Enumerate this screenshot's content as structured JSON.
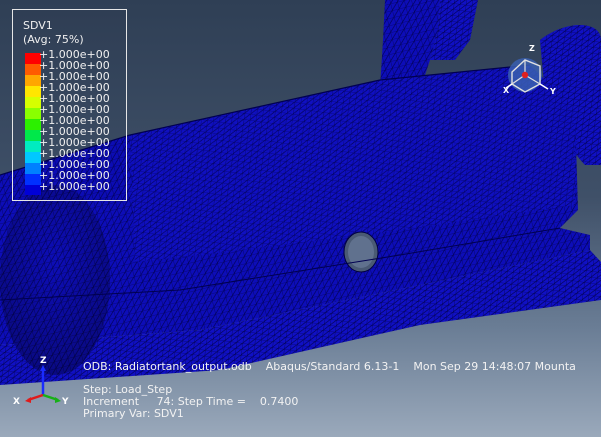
{
  "legend": {
    "title": "SDV1",
    "averaging": "(Avg: 75%)",
    "entries": [
      {
        "label": "+1.000e+00",
        "color": "#ff0000"
      },
      {
        "label": "+1.000e+00",
        "color": "#ff5a00"
      },
      {
        "label": "+1.000e+00",
        "color": "#ffa600"
      },
      {
        "label": "+1.000e+00",
        "color": "#ffe600"
      },
      {
        "label": "+1.000e+00",
        "color": "#d6ff00"
      },
      {
        "label": "+1.000e+00",
        "color": "#8aff00"
      },
      {
        "label": "+1.000e+00",
        "color": "#2cf000"
      },
      {
        "label": "+1.000e+00",
        "color": "#00e84a"
      },
      {
        "label": "+1.000e+00",
        "color": "#00ecc0"
      },
      {
        "label": "+1.000e+00",
        "color": "#00c8ff"
      },
      {
        "label": "+1.000e+00",
        "color": "#0080ff"
      },
      {
        "label": "+1.000e+00",
        "color": "#0030ff"
      },
      {
        "label": "+1.000e+00",
        "color": "#0000d8"
      }
    ]
  },
  "info": {
    "odb_line": "ODB: Radiatortank_output.odb    Abaqus/Standard 6.13-1    Mon Sep 29 14:48:07 Mounta",
    "step_line": "Step: Load_Step",
    "increment_line": "Increment     74: Step Time =    0.7400",
    "primary_var_line": "Primary Var: SDV1"
  },
  "triad": {
    "x": "X",
    "y": "Y",
    "z": "Z"
  },
  "view_cube": {
    "x": "X",
    "y": "Y",
    "z": "Z"
  },
  "colors": {
    "mesh_fill": "#0d0db8",
    "mesh_lines": "#000040",
    "background_top": "#2f3f55",
    "background_bottom": "#9aa9bb"
  }
}
